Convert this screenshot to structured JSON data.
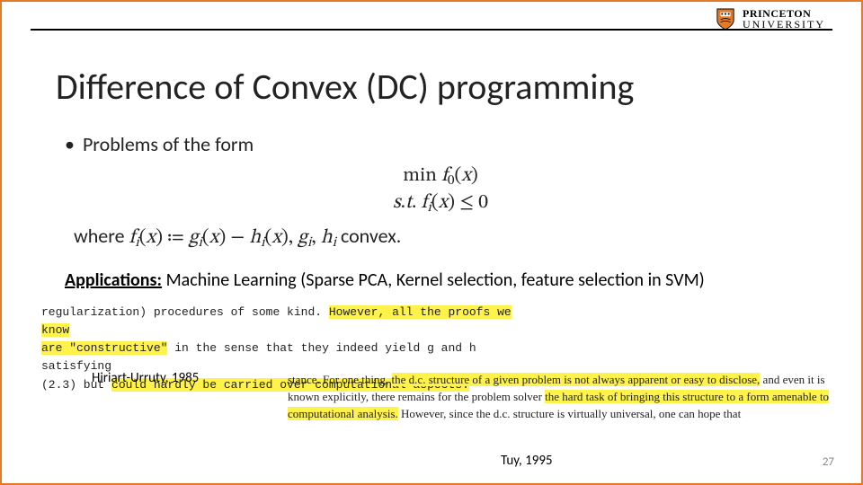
{
  "logo": {
    "line1": "Princeton",
    "line2": "University"
  },
  "title": "Difference of Convex (DC) programming",
  "bullet": "Problems of the form",
  "math": {
    "line1": "min f₀(x)",
    "line2": "s.t. fᵢ(x) ≤ 0"
  },
  "where": {
    "prefix": "where ",
    "formula": "fᵢ(x) ≔ gᵢ(x) − hᵢ(x), gᵢ, hᵢ",
    "suffix": " convex."
  },
  "applications": {
    "label": "Applications:",
    "text": " Machine Learning (Sparse PCA, Kernel selection, feature selection in SVM)"
  },
  "snippet1": {
    "plain_a": "regularization) procedures of some kind. ",
    "hl_a": "However, all the proofs we know",
    "hl_b": "are \"constructive\"",
    "plain_b": " in the sense that they indeed yield g and h satisfying",
    "plain_c": "(2.3) but ",
    "hl_c": "could hardly be carried over computational aspects."
  },
  "citation1": "Hiriart-Urruty, 1985",
  "snippet2": {
    "plain_a": "stance. For one thing, ",
    "hl_a": "the d.c. structure of a given problem is not always apparent or easy to disclose,",
    "plain_b": " and even it is known explicitly, there remains for the problem solver ",
    "hl_b": "the hard task of bringing this structure to a form amenable to computational analysis.",
    "plain_c": " However, since the d.c. structure is virtually universal, one can hope that"
  },
  "citation2": "Tuy, 1995",
  "page_number": "27"
}
